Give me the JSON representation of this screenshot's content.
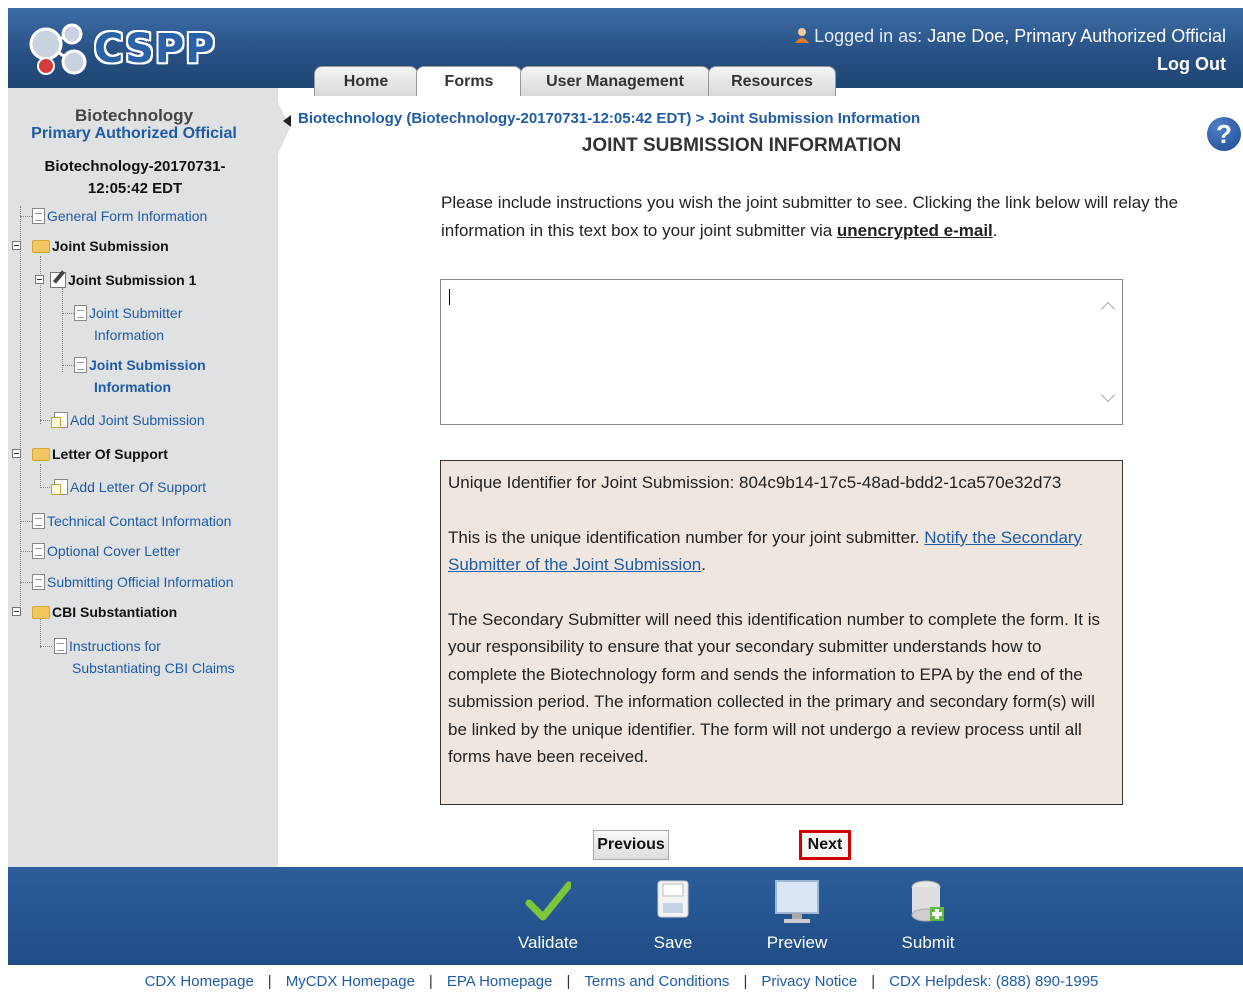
{
  "header": {
    "logo_text": "CSPP",
    "user_prefix": "Logged in as:",
    "user_name": "Jane Doe, Primary Authorized Official",
    "logout_label": "Log Out",
    "tabs": [
      {
        "label": "Home"
      },
      {
        "label": "Forms"
      },
      {
        "label": "User Management"
      },
      {
        "label": "Resources"
      }
    ],
    "active_tab": "Forms"
  },
  "sidebar": {
    "title": "Biotechnology",
    "role": "Primary Authorized Official",
    "form_id": "Biotechnology-20170731-12:05:42 EDT",
    "tree": {
      "general_form_info": "General Form Information",
      "joint_submission": "Joint Submission",
      "joint_submission_1": "Joint Submission 1",
      "joint_submitter_info_1": "Joint Submitter",
      "joint_submitter_info_2": "Information",
      "joint_submission_info_1": "Joint Submission",
      "joint_submission_info_2": "Information",
      "add_joint_submission": "Add Joint Submission",
      "letter_of_support": "Letter Of Support",
      "add_letter_of_support": "Add Letter Of Support",
      "technical_contact": "Technical Contact Information",
      "optional_cover_letter": "Optional Cover Letter",
      "submitting_official": "Submitting Official Information",
      "cbi_substantiation": "CBI Substantiation",
      "instructions_cbi_1": "Instructions for",
      "instructions_cbi_2": "Substantiating CBI Claims"
    }
  },
  "main": {
    "breadcrumb": "Biotechnology (Biotechnology-20170731-12:05:42 EDT) > Joint Submission Information",
    "title": "JOINT SUBMISSION INFORMATION",
    "help_glyph": "?",
    "instructions_text": "Please include instructions you wish the joint submitter to see. Clicking the link below will relay the information in this text box to your joint submitter via ",
    "instructions_emphasis": "unencrypted e-mail",
    "instructions_end": ".",
    "textarea_value": "",
    "info_box": {
      "identifier_label": "Unique Identifier for Joint Submission: ",
      "identifier_value": "804c9b14-17c5-48ad-bdd2-1ca570e32d73",
      "para2_text": "This is the unique identification number for your joint submitter. ",
      "notify_link": "Notify the Secondary Submitter of the Joint Submission",
      "para2_end": ".",
      "para3": "The Secondary Submitter will need this identification number to complete the form. It is your responsibility to ensure that your secondary submitter understands how to complete the Biotechnology form and sends the information to EPA by the end of the submission period. The information collected in the primary and secondary form(s) will be linked by the unique identifier. The form will not undergo a review process until all forms have been received."
    },
    "previous_label": "Previous",
    "next_label": "Next"
  },
  "toolbar": {
    "validate": "Validate",
    "save": "Save",
    "preview": "Preview",
    "submit": "Submit"
  },
  "footer": {
    "links": [
      "CDX Homepage",
      "MyCDX Homepage",
      "EPA Homepage",
      "Terms and Conditions",
      "Privacy Notice",
      "CDX Helpdesk: (888) 890-1995"
    ]
  },
  "colors": {
    "header_blue": "#274f82",
    "link_blue": "#1f5ca8",
    "sidebar_gray": "#dfe1e3",
    "info_box_bg": "#efe6e0",
    "next_highlight": "#d10000"
  }
}
